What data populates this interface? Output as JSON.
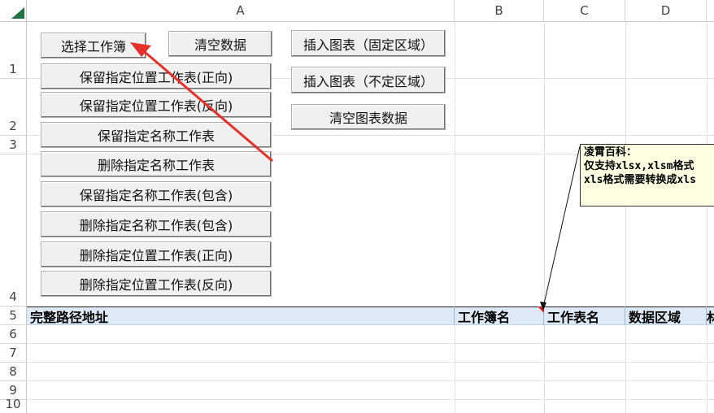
{
  "columns": [
    "A",
    "B",
    "C",
    "D"
  ],
  "rows": [
    "1",
    "2",
    "3",
    "4",
    "5",
    "6",
    "7",
    "8",
    "9",
    "10"
  ],
  "buttons": {
    "select_workbook": "选择工作簿",
    "clear_data": "清空数据",
    "insert_chart_fixed": "插入图表（固定区域）",
    "insert_chart_unfixed": "插入图表（不定区域）",
    "clear_chart_data": "清空图表数据",
    "keep_pos_forward": "保留指定位置工作表(正向)",
    "keep_pos_reverse": "保留指定位置工作表(反向)",
    "keep_name": "保留指定名称工作表",
    "delete_name": "删除指定名称工作表",
    "keep_name_contains": "保留指定名称工作表(包含)",
    "delete_name_contains": "删除指定名称工作表(包含)",
    "delete_pos_forward": "删除指定位置工作表(正向)",
    "delete_pos_reverse": "删除指定位置工作表(反向)"
  },
  "table_headers": {
    "full_path": "完整路径地址",
    "workbook_name": "工作簿名",
    "worksheet_name": "工作表名",
    "data_range": "数据区域",
    "extra": "林"
  },
  "comment": {
    "line1": "凌霄百科：",
    "line2": "仅支持xlsx,xlsm格式",
    "line3": "xls格式需要转换成xls"
  },
  "colors": {
    "header_band": "#dde9f5",
    "comment_bg": "#ffffe1",
    "arrow": "#e8302a",
    "excel_green": "#217346"
  }
}
